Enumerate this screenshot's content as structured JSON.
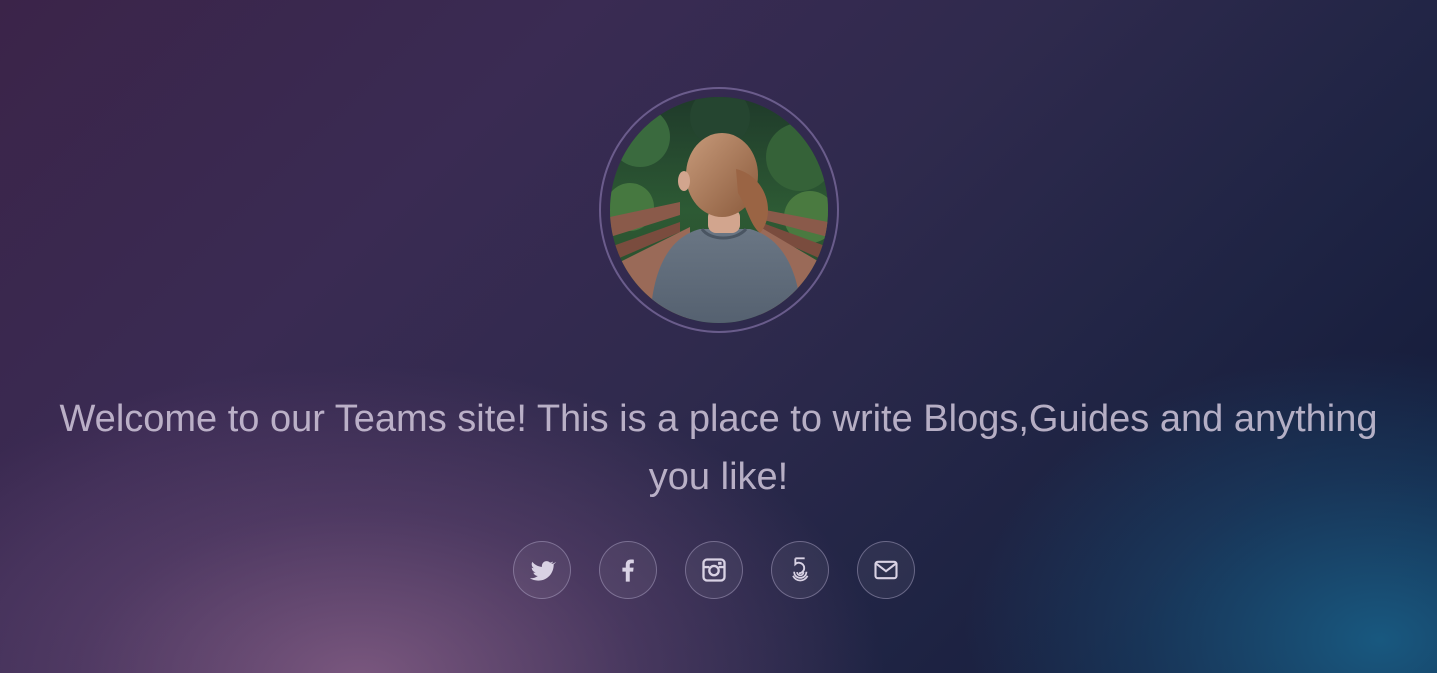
{
  "hero": {
    "avatar_alt": "Woman with ponytail on a wooden bridge in the forest",
    "tagline": "Welcome to our Teams site! This is a place to write Blogs,Guides and anything you like!"
  },
  "socials": [
    {
      "icon": "twitter-icon"
    },
    {
      "icon": "facebook-icon"
    },
    {
      "icon": "instagram-icon"
    },
    {
      "icon": "500px-icon"
    },
    {
      "icon": "email-icon"
    }
  ],
  "colors": {
    "background_top_left": "#3b2449",
    "background_bottom_left": "#7b5a80",
    "background_right": "#101836",
    "background_bottom_right": "#1a5a82",
    "text": "#d7cde1",
    "icon": "#d9d2e4"
  }
}
